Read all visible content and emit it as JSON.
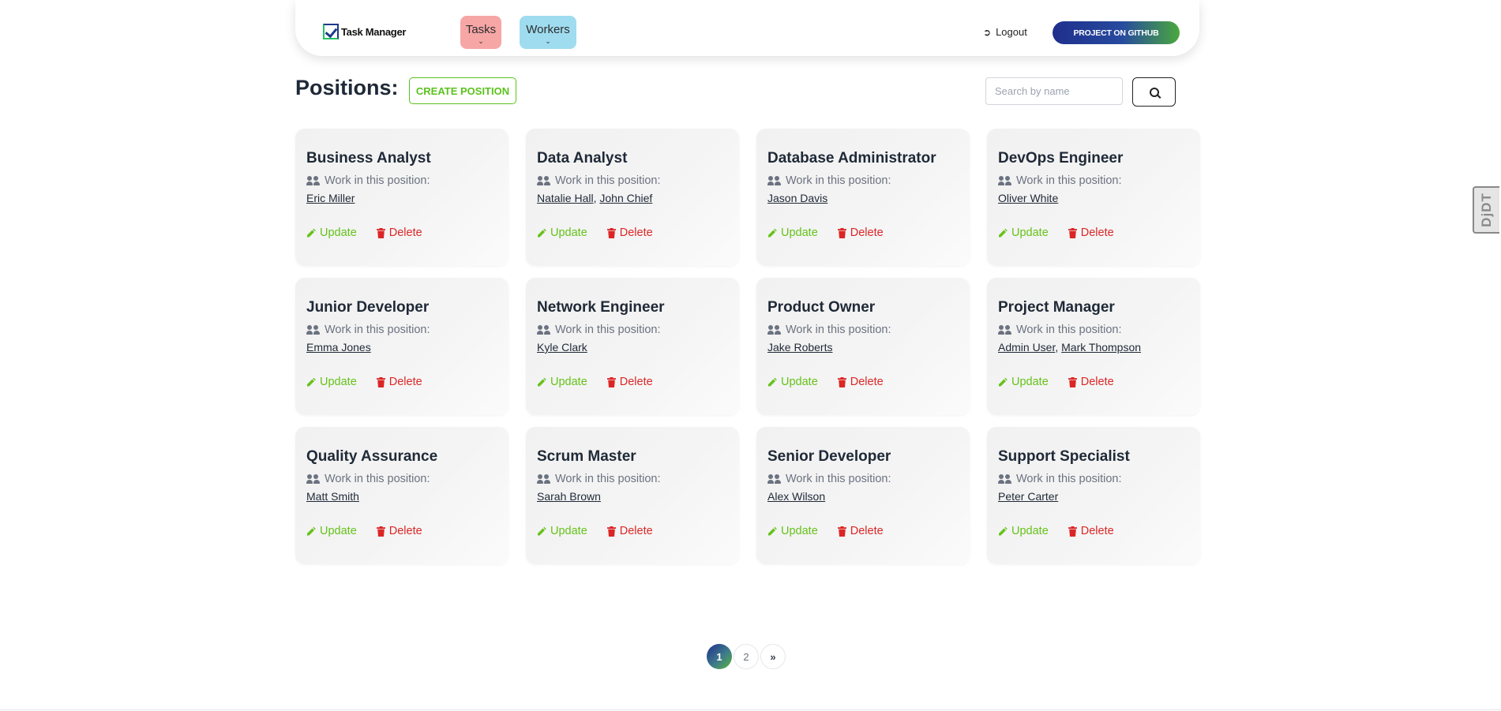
{
  "navbar": {
    "brand": "Task Manager",
    "tasks_label": "Tasks",
    "workers_label": "Workers",
    "logout_label": "Logout",
    "github_label": "PROJECT ON GITHUB"
  },
  "header": {
    "title": "Positions:",
    "create_label": "CREATE POSITION",
    "search_placeholder": "Search by name"
  },
  "card_labels": {
    "work_label": "Work in this position:",
    "update_label": "Update",
    "delete_label": "Delete"
  },
  "positions": [
    {
      "title": "Business Analyst",
      "workers": [
        "Eric Miller"
      ]
    },
    {
      "title": "Data Analyst",
      "workers": [
        "Natalie Hall",
        "John Chief"
      ]
    },
    {
      "title": "Database Administrator",
      "workers": [
        "Jason Davis"
      ]
    },
    {
      "title": "DevOps Engineer",
      "workers": [
        "Oliver White"
      ]
    },
    {
      "title": "Junior Developer",
      "workers": [
        "Emma Jones"
      ]
    },
    {
      "title": "Network Engineer",
      "workers": [
        "Kyle Clark"
      ]
    },
    {
      "title": "Product Owner",
      "workers": [
        "Jake Roberts"
      ]
    },
    {
      "title": "Project Manager",
      "workers": [
        "Admin User",
        "Mark Thompson"
      ]
    },
    {
      "title": "Quality Assurance",
      "workers": [
        "Matt Smith"
      ]
    },
    {
      "title": "Scrum Master",
      "workers": [
        "Sarah Brown"
      ]
    },
    {
      "title": "Senior Developer",
      "workers": [
        "Alex Wilson"
      ]
    },
    {
      "title": "Support Specialist",
      "workers": [
        "Peter Carter"
      ]
    }
  ],
  "pagination": {
    "pages": [
      "1",
      "2"
    ],
    "current": "1",
    "next_label": "»"
  },
  "side_tab": "DjDT",
  "colors": {
    "update": "#66c21a",
    "delete": "#dc2626",
    "tasks_pill": "#f7a6a6",
    "workers_pill": "#9fdcf0"
  }
}
